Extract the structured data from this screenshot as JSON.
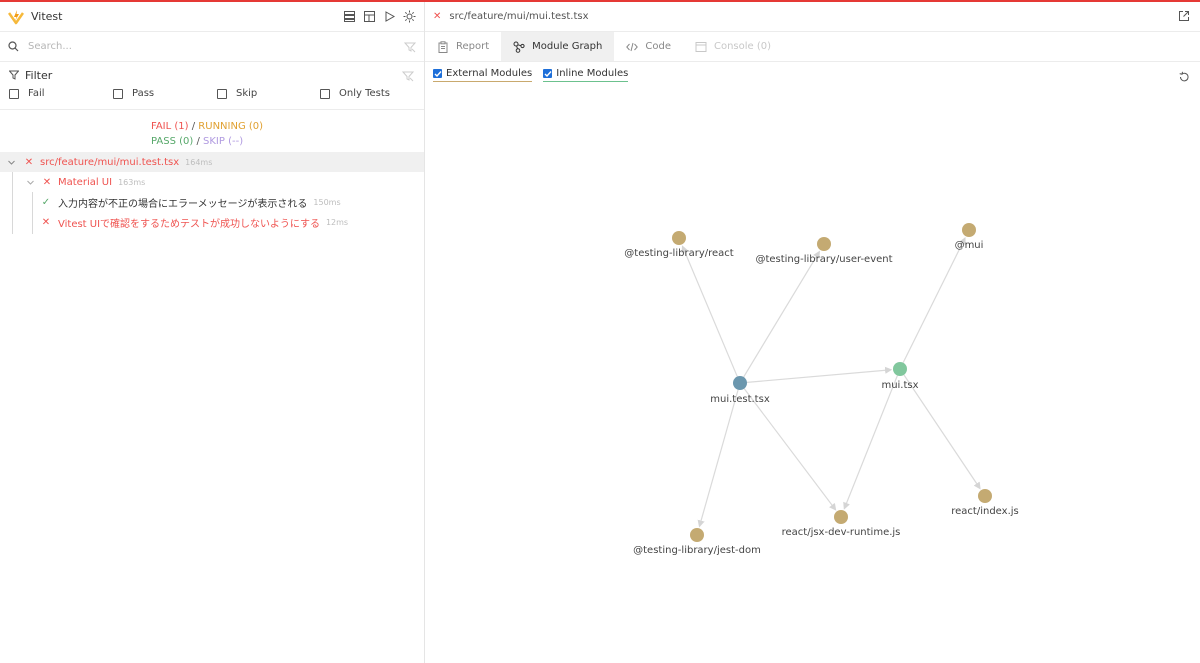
{
  "app": {
    "title": "Vitest"
  },
  "colors": {
    "fail": "#ef5350",
    "pass": "#57a86a",
    "running": "#e0a030",
    "skip": "#b09ae0",
    "external_node": "#c4aa72",
    "inline_node": "#81c79d",
    "root_node": "#6b97ae",
    "accent_line": "#e53935"
  },
  "sidebar": {
    "toolbar_icons": [
      "collapse-icon",
      "dashboard-icon",
      "play-icon",
      "theme-icon"
    ],
    "search_placeholder": "Search...",
    "filter": {
      "title": "Filter",
      "options": [
        "Fail",
        "Pass",
        "Skip",
        "Only Tests"
      ]
    },
    "summary": {
      "fail": "FAIL (1)",
      "running": "RUNNING (0)",
      "pass": "PASS (0)",
      "skip": "SKIP (--)",
      "sep": "/"
    },
    "tree": {
      "file": {
        "name": "src/feature/mui/mui.test.tsx",
        "duration": "164ms"
      },
      "suite": {
        "name": "Material UI",
        "duration": "163ms"
      },
      "tests": [
        {
          "name": "入力内容が不正の場合にエラーメッセージが表示される",
          "duration": "150ms",
          "status": "pass"
        },
        {
          "name": "Vitest UIで確認をするためテストが成功しないようにする",
          "duration": "12ms",
          "status": "fail"
        }
      ]
    }
  },
  "main": {
    "file_path": "src/feature/mui/mui.test.tsx",
    "tabs": [
      "Report",
      "Module Graph",
      "Code",
      "Console (0)"
    ],
    "active_tab": "Module Graph",
    "graph_controls": {
      "external": "External Modules",
      "inline": "Inline Modules"
    },
    "graph": {
      "nodes": [
        {
          "id": "mui.test.tsx",
          "kind": "root"
        },
        {
          "id": "mui.tsx",
          "kind": "inline"
        },
        {
          "id": "@testing-library/react",
          "kind": "external"
        },
        {
          "id": "@testing-library/user-event",
          "kind": "external"
        },
        {
          "id": "@mui",
          "kind": "external"
        },
        {
          "id": "@testing-library/jest-dom",
          "kind": "external"
        },
        {
          "id": "react/jsx-dev-runtime.js",
          "kind": "external"
        },
        {
          "id": "react/index.js",
          "kind": "external"
        }
      ],
      "edges": [
        [
          "mui.test.tsx",
          "@testing-library/react"
        ],
        [
          "mui.test.tsx",
          "@testing-library/user-event"
        ],
        [
          "mui.test.tsx",
          "mui.tsx"
        ],
        [
          "mui.test.tsx",
          "@testing-library/jest-dom"
        ],
        [
          "mui.test.tsx",
          "react/jsx-dev-runtime.js"
        ],
        [
          "mui.tsx",
          "@mui"
        ],
        [
          "mui.tsx",
          "react/jsx-dev-runtime.js"
        ],
        [
          "mui.tsx",
          "react/index.js"
        ]
      ]
    }
  }
}
